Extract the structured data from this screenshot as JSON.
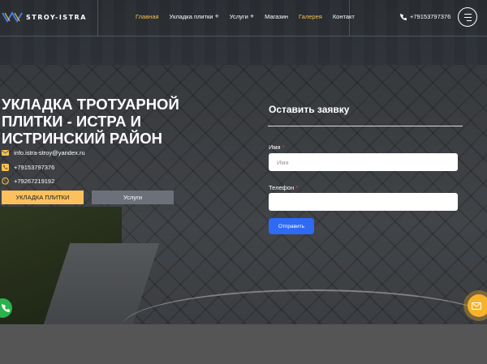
{
  "brand": {
    "name": "STROY-ISTRA",
    "accent": "#f5c24d"
  },
  "nav": {
    "items": [
      {
        "label": "Главная",
        "active": true,
        "has_submenu": false
      },
      {
        "label": "Укладка плитки",
        "active": false,
        "has_submenu": true
      },
      {
        "label": "Услуги",
        "active": false,
        "has_submenu": true
      },
      {
        "label": "Магазин",
        "active": false,
        "has_submenu": false
      },
      {
        "label": "Галерея",
        "active": true,
        "has_submenu": false
      },
      {
        "label": "Контакт",
        "active": false,
        "has_submenu": false
      }
    ],
    "submenu_glyph": "+"
  },
  "header": {
    "phone": "+79153797376",
    "phone_icon": "phone-icon",
    "menu_icon": "hamburger-menu-icon"
  },
  "hero": {
    "title": "УКЛАДКА ТРОТУАРНОЙ ПЛИТКИ - ИСТРА И ИСТРИНСКИЙ РАЙОН",
    "contacts": [
      {
        "icon": "envelope-icon",
        "text": "info.istra-stroy@yandex.ru"
      },
      {
        "icon": "phone-icon",
        "text": "+79153797376"
      },
      {
        "icon": "whatsapp-icon",
        "text": "+79267219192"
      }
    ],
    "primary_button": "УКЛАДКА ПЛИТКИ",
    "secondary_button": "Услуги",
    "primary_color": "#fcc15e"
  },
  "form": {
    "title": "Оставить заявку",
    "name_label": "Имя",
    "name_placeholder": "Имя",
    "phone_label": "Телефон",
    "phone_value": "",
    "required_mark": "*",
    "submit": "Отправить",
    "submit_color": "#2f6af5"
  },
  "floating": {
    "call_icon": "phone-icon",
    "mail_icon": "envelope-icon"
  }
}
